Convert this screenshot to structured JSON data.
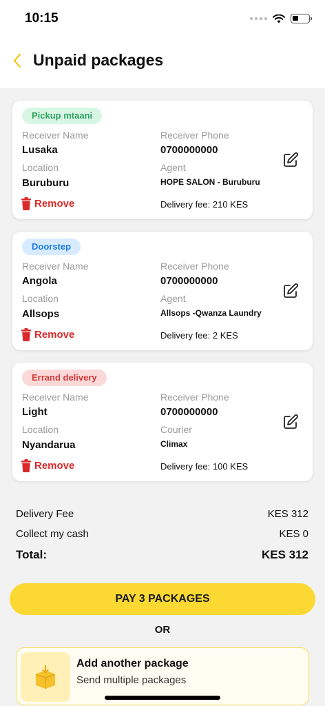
{
  "status_bar": {
    "time": "10:15"
  },
  "header": {
    "title": "Unpaid packages",
    "back_icon": "chevron-left-icon"
  },
  "colors": {
    "accent": "#fcd932",
    "back_arrow": "#f5c518",
    "remove": "#d92b2b",
    "tag_green": "#2ea35f",
    "tag_blue": "#1f7ae0",
    "tag_red": "#d23a3a"
  },
  "packages": [
    {
      "tag": "Pickup mtaani",
      "receiver_name_label": "Receiver Name",
      "receiver_name": "Lusaka",
      "receiver_phone_label": "Receiver Phone",
      "receiver_phone": "0700000000",
      "location_label": "Location",
      "location": "Buruburu",
      "agent_label": "Agent",
      "agent": "HOPE SALON - Buruburu",
      "remove_label": "Remove",
      "fee": "Delivery fee: 210 KES"
    },
    {
      "tag": "Doorstep",
      "receiver_name_label": "Receiver Name",
      "receiver_name": "Angola",
      "receiver_phone_label": "Receiver Phone",
      "receiver_phone": "0700000000",
      "location_label": "Location",
      "location": "Allsops",
      "agent_label": "Agent",
      "agent": "Allsops -Qwanza Laundry",
      "remove_label": "Remove",
      "fee": "Delivery fee: 2 KES"
    },
    {
      "tag": "Errand delivery",
      "receiver_name_label": "Receiver Name",
      "receiver_name": "Light",
      "receiver_phone_label": "Receiver Phone",
      "receiver_phone": "0700000000",
      "location_label": "Location",
      "location": "Nyandarua",
      "agent_label": "Courier",
      "agent": "Climax",
      "remove_label": "Remove",
      "fee": "Delivery fee: 100 KES"
    }
  ],
  "summary": {
    "delivery_fee_label": "Delivery Fee",
    "delivery_fee": "KES 312",
    "collect_label": "Collect my cash",
    "collect": "KES 0",
    "total_label": "Total:",
    "total": "KES 312"
  },
  "pay_button": "PAY 3 PACKAGES",
  "or_text": "OR",
  "add_package": {
    "title": "Add another package",
    "subtitle": "Send multiple packages",
    "icon": "package-box-icon"
  }
}
